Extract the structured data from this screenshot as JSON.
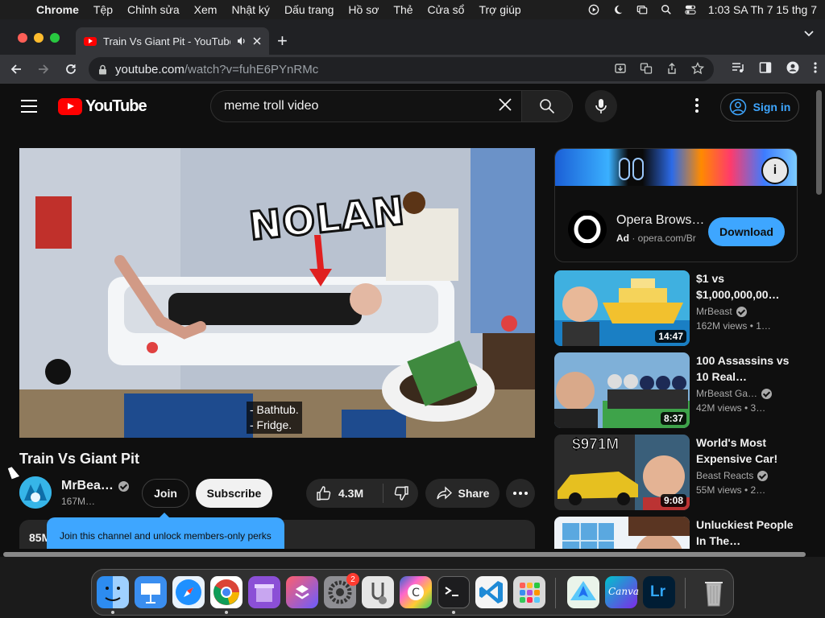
{
  "menubar": {
    "app": "Chrome",
    "items": [
      "Tệp",
      "Chỉnh sửa",
      "Xem",
      "Nhật ký",
      "Dấu trang",
      "Hồ sơ",
      "Thẻ",
      "Cửa sổ",
      "Trợ giúp"
    ],
    "clock": "1:03 SA Th 7 15 thg 7"
  },
  "browser": {
    "tab_title": "Train Vs Giant Pit - YouTube",
    "url_host": "youtube.com",
    "url_path": "/watch?v=fuhE6PYnRMc"
  },
  "youtube": {
    "logo_text": "YouTube",
    "search_value": "meme troll video",
    "sign_in": "Sign in"
  },
  "video": {
    "overlay_text": "NOLAN",
    "caption_line1": "- Bathtub.",
    "caption_line2": "- Fridge.",
    "title": "Train Vs Giant Pit",
    "channel": "MrBea…",
    "subscribers": "167M…",
    "join": "Join",
    "subscribe": "Subscribe",
    "likes": "4.3M",
    "share": "Share",
    "views_snippet": "85M",
    "tooltip": "Join this channel and unlock members-only perks"
  },
  "ad": {
    "title": "Opera Brows…",
    "label": "Ad",
    "domain": "opera.com/Br",
    "button": "Download"
  },
  "recommendations": [
    {
      "title": "$1 vs $1,000,000,00…",
      "channel": "MrBeast",
      "meta": "162M views • 1…",
      "duration": "14:47"
    },
    {
      "title": "100 Assassins vs 10 Real…",
      "channel": "MrBeast Ga…",
      "meta": "42M views • 3…",
      "duration": "8:37"
    },
    {
      "title": "World's Most Expensive Car!",
      "channel": "Beast Reacts",
      "meta": "55M views • 2…",
      "duration": "9:08",
      "thumb_text": "$971M"
    },
    {
      "title": "Unluckiest People In The…",
      "channel": "",
      "meta": "",
      "duration": ""
    }
  ],
  "dock": {
    "settings_badge": "2",
    "canva_label": "Canva",
    "lr_label": "Lr"
  }
}
